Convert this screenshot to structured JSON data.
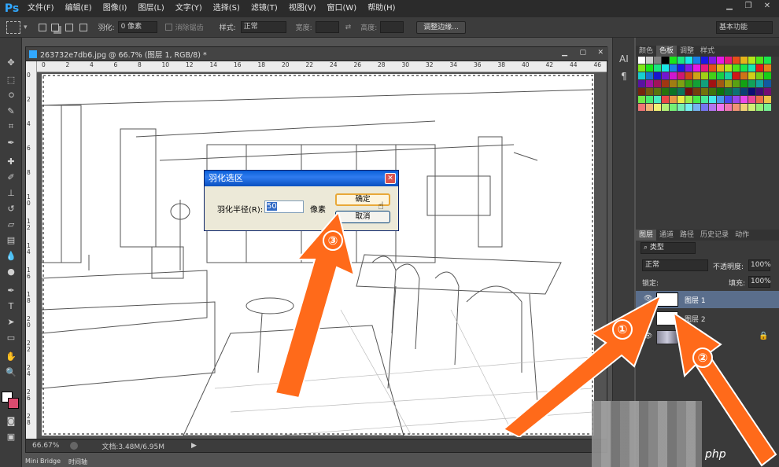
{
  "menubar": {
    "logo": "Ps",
    "items": [
      "文件(F)",
      "编辑(E)",
      "图像(I)",
      "图层(L)",
      "文字(Y)",
      "选择(S)",
      "滤镜(T)",
      "视图(V)",
      "窗口(W)",
      "帮助(H)"
    ]
  },
  "optbar": {
    "feather_label": "羽化:",
    "feather_value": "0 像素",
    "antialias_label": "消除锯齿",
    "style_label": "样式:",
    "style_value": "正常",
    "width_label": "宽度:",
    "height_label": "高度:",
    "refine_button": "调整边缘...",
    "workspace": "基本功能"
  },
  "document": {
    "tab_title": "263732e7db6.jpg @ 66.7% (图层 1, RGB/8) *",
    "ruler_top_ticks": [
      "0",
      "2",
      "4",
      "6",
      "8",
      "10",
      "12",
      "14",
      "16",
      "18",
      "20",
      "22",
      "24",
      "26",
      "28",
      "30",
      "32",
      "34",
      "36",
      "38",
      "40",
      "42",
      "44",
      "46"
    ],
    "ruler_left_ticks": [
      "0",
      "2",
      "4",
      "6",
      "8",
      "1\n0",
      "1\n2",
      "1\n4",
      "1\n6",
      "1\n8",
      "2\n0",
      "2\n2",
      "2\n4",
      "2\n6",
      "2\n8"
    ],
    "zoom": "66.67%",
    "doc_info": "文档:3.48M/6.95M"
  },
  "bottom_tabs": [
    "Mini Bridge",
    "时间轴"
  ],
  "dialog": {
    "title": "羽化选区",
    "radius_label": "羽化半径(R):",
    "radius_value": "50",
    "unit": "像素",
    "ok_button": "确定",
    "cancel_button": "取消"
  },
  "panels": {
    "color_tabs": [
      "颜色",
      "色板",
      "调整",
      "样式"
    ],
    "layer_tabs": [
      "图层",
      "通道",
      "路径",
      "历史记录",
      "动作"
    ],
    "filter_kind": "类型",
    "blend_mode": "正常",
    "opacity_label": "不透明度:",
    "opacity_value": "100%",
    "lock_label": "锁定:",
    "fill_label": "填充:",
    "fill_value": "100%",
    "layers": [
      {
        "name": "图层 1",
        "selected": true
      },
      {
        "name": "图层 2",
        "selected": false
      },
      {
        "name": "",
        "selected": false,
        "locked": true
      }
    ]
  },
  "annotations": [
    "①",
    "②",
    "③"
  ],
  "watermark": "php",
  "colors": {
    "accent_arrow": "#ff6a1a",
    "ps_blue": "#31a8ff"
  }
}
